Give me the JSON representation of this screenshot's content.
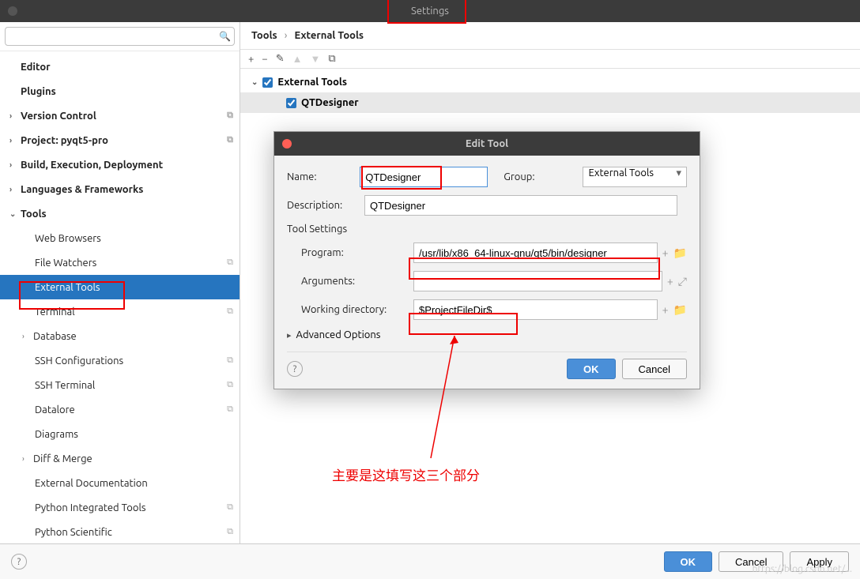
{
  "window": {
    "title": "Settings"
  },
  "sidebar": {
    "search_placeholder": "",
    "items": [
      {
        "label": "Editor",
        "chev": "",
        "copy": false
      },
      {
        "label": "Plugins",
        "chev": "",
        "copy": false
      },
      {
        "label": "Version Control",
        "chev": "›",
        "copy": true
      },
      {
        "label": "Project: pyqt5-pro",
        "chev": "›",
        "copy": true
      },
      {
        "label": "Build, Execution, Deployment",
        "chev": "›",
        "copy": false
      },
      {
        "label": "Languages & Frameworks",
        "chev": "›",
        "copy": false
      },
      {
        "label": "Tools",
        "chev": "⌄",
        "copy": false
      }
    ],
    "tools_children": [
      {
        "label": "Web Browsers",
        "copy": false
      },
      {
        "label": "File Watchers",
        "copy": true
      },
      {
        "label": "External Tools",
        "copy": false,
        "selected": true
      },
      {
        "label": "Terminal",
        "copy": true
      },
      {
        "label": "Database",
        "chev": "›",
        "copy": false
      },
      {
        "label": "SSH Configurations",
        "copy": true
      },
      {
        "label": "SSH Terminal",
        "copy": true
      },
      {
        "label": "Datalore",
        "copy": true
      },
      {
        "label": "Diagrams",
        "copy": false
      },
      {
        "label": "Diff & Merge",
        "chev": "›",
        "copy": false
      },
      {
        "label": "External Documentation",
        "copy": false
      },
      {
        "label": "Python Integrated Tools",
        "copy": true
      },
      {
        "label": "Python Scientific",
        "copy": true
      }
    ]
  },
  "breadcrumb": {
    "a": "Tools",
    "b": "External Tools"
  },
  "tree_panel": {
    "root": "External Tools",
    "child": "QTDesigner"
  },
  "dialog": {
    "title": "Edit Tool",
    "name_label": "Name:",
    "name_value": "QTDesigner",
    "group_label": "Group:",
    "group_value": "External Tools",
    "desc_label": "Description:",
    "desc_value": "QTDesigner",
    "tool_settings": "Tool Settings",
    "program_label": "Program:",
    "program_value": "/usr/lib/x86_64-linux-gnu/qt5/bin/designer",
    "args_label": "Arguments:",
    "args_value": "",
    "wd_label": "Working directory:",
    "wd_value": "$ProjectFileDir$",
    "advanced": "Advanced Options",
    "ok": "OK",
    "cancel": "Cancel"
  },
  "bottom": {
    "ok": "OK",
    "cancel": "Cancel",
    "apply": "Apply"
  },
  "annotation": "主要是这填写这三个部分",
  "watermark": "https://blog.csdn.net/..."
}
